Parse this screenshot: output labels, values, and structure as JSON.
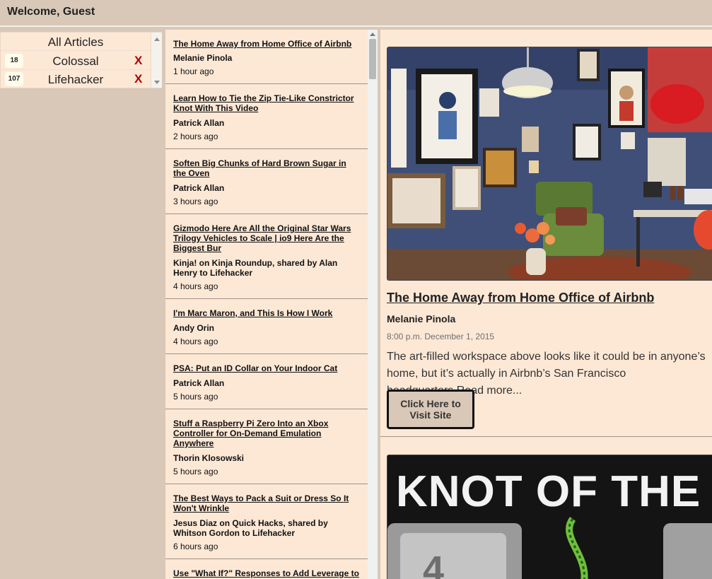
{
  "header": {
    "welcome": "Welcome, Guest"
  },
  "feeds": {
    "all_label": "All Articles",
    "items": [
      {
        "count": "18",
        "name": "Colossal",
        "remove": "X"
      },
      {
        "count": "107",
        "name": "Lifehacker",
        "remove": "X"
      }
    ]
  },
  "articles": [
    {
      "title": "The Home Away from Home Office of Airbnb",
      "author": "Melanie Pinola",
      "time": "1 hour ago"
    },
    {
      "title": "Learn How to Tie the Zip Tie-Like Constrictor Knot With This Video",
      "author": "Patrick Allan",
      "time": "2 hours ago"
    },
    {
      "title": "Soften Big Chunks of Hard Brown Sugar in the Oven",
      "author": "Patrick Allan",
      "time": "3 hours ago"
    },
    {
      "title": "Gizmodo Here Are All the Original Star Wars Trilogy Vehicles to Scale | io9 Here Are the Biggest Bur",
      "author": "Kinja! on Kinja Roundup, shared by Alan Henry to Lifehacker",
      "time": "4 hours ago"
    },
    {
      "title": "I'm Marc Maron, and This Is How I Work",
      "author": "Andy Orin",
      "time": "4 hours ago"
    },
    {
      "title": "PSA: Put an ID Collar on Your Indoor Cat",
      "author": "Patrick Allan",
      "time": "5 hours ago"
    },
    {
      "title": "Stuff a Raspberry Pi Zero Into an Xbox Controller for On-Demand Emulation Anywhere",
      "author": "Thorin Klosowski",
      "time": "5 hours ago"
    },
    {
      "title": "The Best Ways to Pack a Suit or Dress So It Won't Wrinkle",
      "author": "Jesus Diaz on Quick Hacks, shared by Whitson Gordon to Lifehacker",
      "time": "6 hours ago"
    },
    {
      "title": "Use \"What If?\" Responses to Add Leverage to",
      "author": "",
      "time": ""
    }
  ],
  "reader": {
    "title": "The Home Away from Home Office of Airbnb",
    "author": "Melanie Pinola",
    "date": "8:00 p.m. December 1, 2015",
    "body": "The art-filled workspace above looks like it could be in anyone’s home, but it’s actually in Airbnb’s San Francisco headquarters.Read more...",
    "button": "Click Here to Visit Site",
    "second_image_text": "KNOT OF THE WEEK"
  }
}
